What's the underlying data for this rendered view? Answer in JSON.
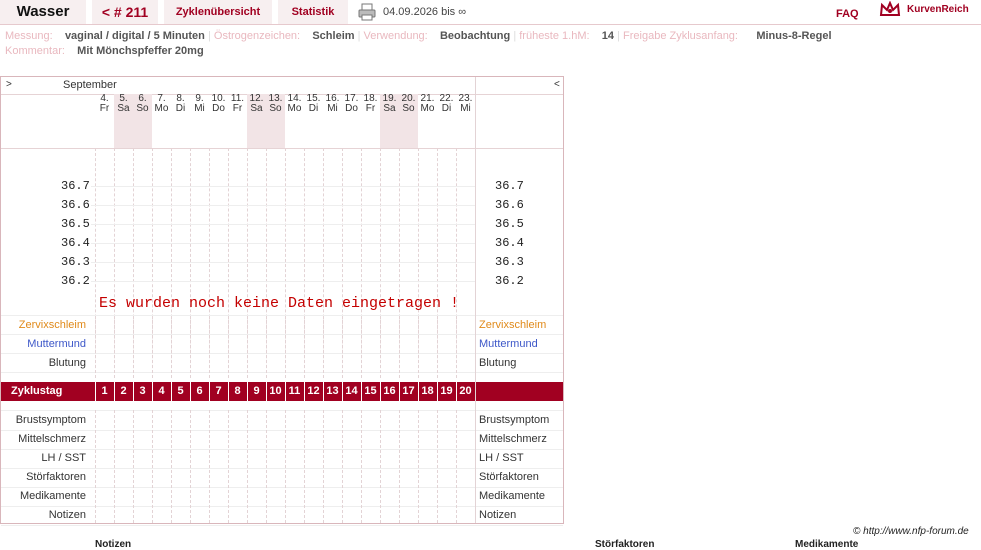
{
  "header": {
    "name": "Wasser",
    "cycle": "< # 211",
    "overview": "Zyklenübersicht",
    "stats": "Statistik",
    "date_range": "04.09.2026 bis ∞",
    "faq": "FAQ",
    "logo": "KurvenReich"
  },
  "meta": {
    "messung_k": "Messung:",
    "messung_v": "vaginal / digital / 5 Minuten",
    "oestrogen_k": "Östrogenzeichen:",
    "oestrogen_v": "Schleim",
    "verwendung_k": "Verwendung:",
    "verwendung_v": "Beobachtung",
    "fhm_k": "früheste 1.hM:",
    "fhm_v": "14",
    "freigabe_k": "Freigabe Zyklusanfang:",
    "freigabe_v": "Minus-8-Regel",
    "kommentar_k": "Kommentar:",
    "kommentar_v": "Mit Mönchspfeffer  20mg"
  },
  "chart": {
    "nav_left": ">",
    "nav_right": "<",
    "month": "September",
    "days": [
      {
        "d": "4.",
        "w": "Fr",
        "we": false
      },
      {
        "d": "5.",
        "w": "Sa",
        "we": true
      },
      {
        "d": "6.",
        "w": "So",
        "we": true
      },
      {
        "d": "7.",
        "w": "Mo",
        "we": false
      },
      {
        "d": "8.",
        "w": "Di",
        "we": false
      },
      {
        "d": "9.",
        "w": "Mi",
        "we": false
      },
      {
        "d": "10.",
        "w": "Do",
        "we": false
      },
      {
        "d": "11.",
        "w": "Fr",
        "we": false
      },
      {
        "d": "12.",
        "w": "Sa",
        "we": true
      },
      {
        "d": "13.",
        "w": "So",
        "we": true
      },
      {
        "d": "14.",
        "w": "Mo",
        "we": false
      },
      {
        "d": "15.",
        "w": "Di",
        "we": false
      },
      {
        "d": "16.",
        "w": "Mi",
        "we": false
      },
      {
        "d": "17.",
        "w": "Do",
        "we": false
      },
      {
        "d": "18.",
        "w": "Fr",
        "we": false
      },
      {
        "d": "19.",
        "w": "Sa",
        "we": true
      },
      {
        "d": "20.",
        "w": "So",
        "we": true
      },
      {
        "d": "21.",
        "w": "Mo",
        "we": false
      },
      {
        "d": "22.",
        "w": "Di",
        "we": false
      },
      {
        "d": "23.",
        "w": "Mi",
        "we": false
      }
    ],
    "temps": [
      "36.7",
      "36.6",
      "36.5",
      "36.4",
      "36.3",
      "36.2"
    ],
    "no_data": "Es wurden noch keine Daten eingetragen !",
    "rows_top": [
      "Zervixschleim",
      "Muttermund",
      "Blutung"
    ],
    "cycle_label": "Zyklustag",
    "cycle_days": [
      "1",
      "2",
      "3",
      "4",
      "5",
      "6",
      "7",
      "8",
      "9",
      "10",
      "11",
      "12",
      "13",
      "14",
      "15",
      "16",
      "17",
      "18",
      "19",
      "20"
    ],
    "rows_bottom": [
      "Brustsymptom",
      "Mittelschmerz",
      "LH / SST",
      "Störfaktoren",
      "Medikamente",
      "Notizen"
    ]
  },
  "footer": {
    "copyright": "© http://www.nfp-forum.de",
    "cut1": "Notizen",
    "cut2": "Störfaktoren",
    "cut3": "Medikamente"
  },
  "colors": {
    "accent": "#a10021",
    "weekend": "#f2e4e6",
    "cervix": "#e08a1a",
    "cervix_os": "#3d57c8"
  }
}
